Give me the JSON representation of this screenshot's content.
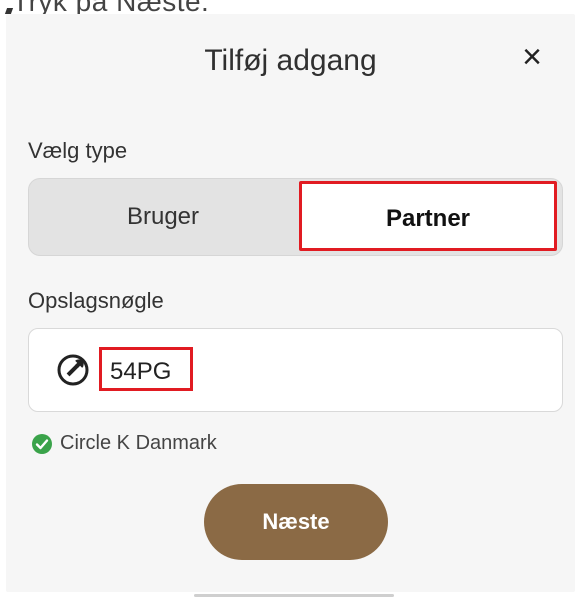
{
  "caption": "Tryk på Næste.",
  "dialog": {
    "title": "Tilføj adgang",
    "close_icon": "close-icon",
    "type_label": "Vælg type",
    "type_options": [
      "Bruger",
      "Partner"
    ],
    "type_selected": "Partner",
    "key_label": "Opslagsnøgle",
    "key_icon": "wrench-icon",
    "key_value": "54PG",
    "status_icon": "check-circle-icon",
    "status_text": "Circle K Danmark",
    "next_label": "Næste"
  },
  "colors": {
    "accent": "#8b6a45",
    "highlight": "#e11b22",
    "success": "#3aa34a"
  }
}
